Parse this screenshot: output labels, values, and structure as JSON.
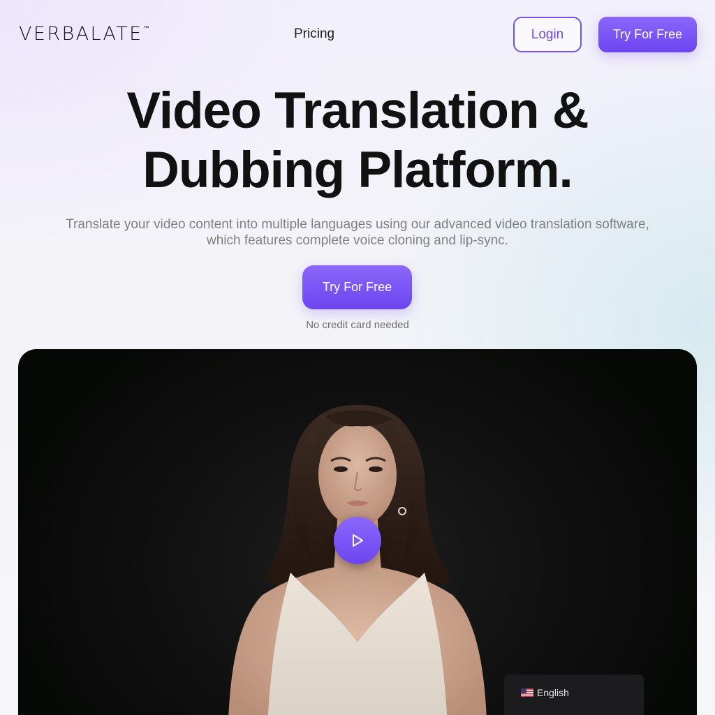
{
  "header": {
    "logo_text": "VERBALATE",
    "logo_tm": "™",
    "nav_pricing": "Pricing",
    "login_label": "Login",
    "try_label": "Try For Free"
  },
  "hero": {
    "title_line1": "Video Translation &",
    "title_line2": "Dubbing Platform.",
    "subtitle": "Translate your video content into multiple languages using our advanced video translation software, which features complete voice cloning and lip-sync.",
    "cta_label": "Try For Free",
    "note": "No credit card needed"
  },
  "video": {
    "play_icon": "play-icon"
  },
  "language_selector": {
    "flag_icon": "us-flag-icon",
    "label": "English"
  },
  "colors": {
    "accent": "#7652f0",
    "accent_light": "#8b67fb",
    "video_bg": "#0f0f0f",
    "language_bg": "#1c1c1e"
  }
}
